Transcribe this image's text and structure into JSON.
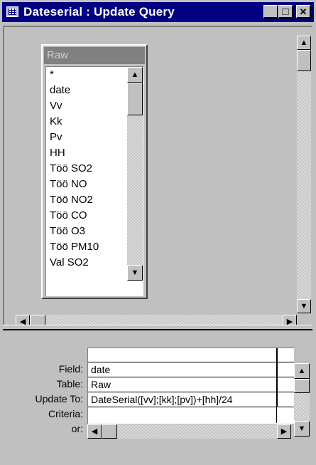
{
  "window": {
    "title": "Dateserial : Update Query",
    "buttons": {
      "minimize": "_",
      "maximize": "□",
      "close": "✕"
    }
  },
  "field_list": {
    "table_name": "Raw",
    "fields": [
      "*",
      "date",
      "Vv",
      "Kk",
      "Pv",
      "HH",
      "Töö SO2",
      "Töö NO",
      "Töö NO2",
      "Töö CO",
      "Töö O3",
      "Töö PM10",
      "Val SO2"
    ]
  },
  "grid": {
    "row_labels": {
      "field": "Field:",
      "table": "Table:",
      "update_to": "Update To:",
      "criteria": "Criteria:",
      "or": "or:"
    },
    "column1": {
      "field": "date",
      "table": "Raw",
      "update_to": "DateSerial([vv];[kk];[pv])+[hh]/24",
      "criteria": "",
      "or": ""
    }
  },
  "icons": {
    "title": "query-grid-icon",
    "arrow_up": "▲",
    "arrow_down": "▼",
    "arrow_left": "◀",
    "arrow_right": "▶"
  },
  "colors": {
    "title_bar": "#000080",
    "face": "#c0c0c0",
    "field_list_title": "#808080"
  }
}
